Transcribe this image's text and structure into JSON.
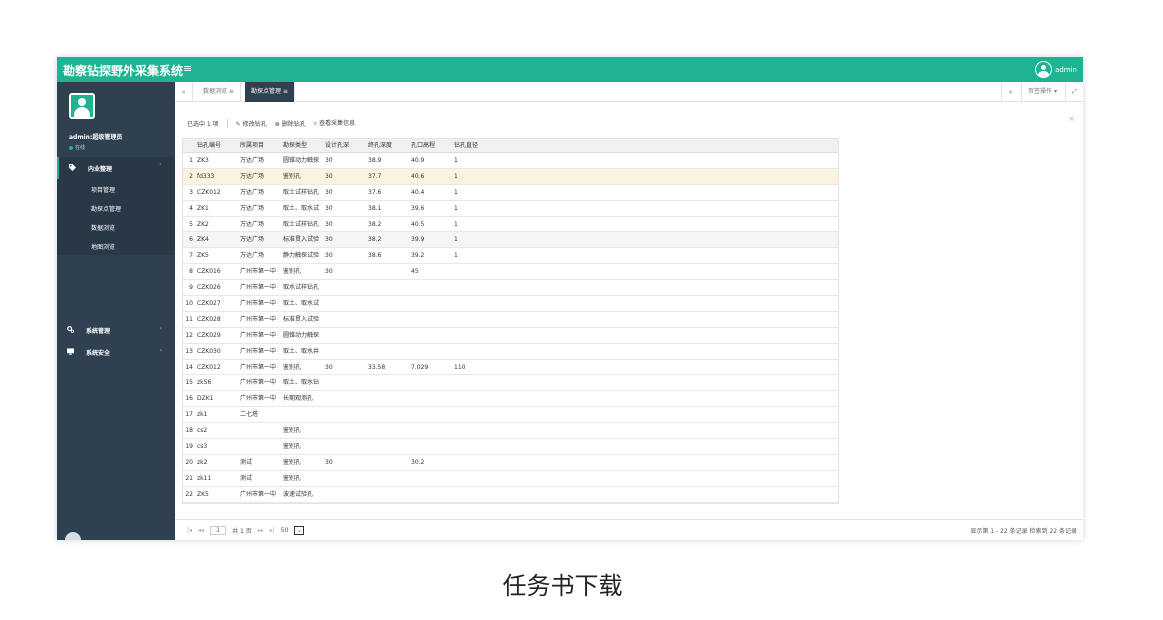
{
  "app": {
    "title": "勘察钻探野外采集系统",
    "menu_toggle": "≡",
    "user": "admin"
  },
  "sidebar": {
    "user_name": "admin:超级管理员",
    "status": "在线",
    "groups": [
      {
        "label": "内业整理",
        "icon": "tag-icon",
        "arrow": "˅",
        "items": [
          "项目管理",
          "勘探点管理",
          "数据浏览",
          "地图浏览"
        ]
      },
      {
        "label": "系统管理",
        "icon": "cogs-icon",
        "arrow": "‹"
      },
      {
        "label": "系统安全",
        "icon": "monitor-icon",
        "arrow": "‹"
      }
    ]
  },
  "tabs": {
    "back": "«",
    "forward": "»",
    "items": [
      {
        "label": "数据浏览 ≡"
      },
      {
        "label": "勘探点管理 ≡"
      }
    ],
    "page_ops": "页签操作 ▾",
    "fullscreen": "⤢"
  },
  "toolbar": {
    "selected": "已选中 1 项",
    "edit": "修改钻孔",
    "delete": "删除钻孔",
    "view": "查看采集信息",
    "close": "×"
  },
  "table": {
    "columns": [
      "",
      "钻孔编号",
      "所属项目",
      "勘探类型",
      "设计孔深",
      "终孔深度",
      "孔口高程",
      "钻孔直径"
    ],
    "rows": [
      [
        "1",
        "ZK3",
        "万达广场",
        "圆锥动力触探",
        "30",
        "38.9",
        "40.9",
        "1"
      ],
      [
        "2",
        "fd333",
        "万达广场",
        "鉴别孔",
        "30",
        "37.7",
        "40.6",
        "1"
      ],
      [
        "3",
        "CZK012",
        "万达广场",
        "取土试样钻孔",
        "30",
        "37.6",
        "40.4",
        "1"
      ],
      [
        "4",
        "ZK1",
        "万达广场",
        "取土、取水试",
        "30",
        "38.1",
        "39.6",
        "1"
      ],
      [
        "5",
        "ZK2",
        "万达广场",
        "取土试样钻孔",
        "30",
        "38.2",
        "40.5",
        "1"
      ],
      [
        "6",
        "ZK4",
        "万达广场",
        "标准贯入试验",
        "30",
        "38.2",
        "39.9",
        "1"
      ],
      [
        "7",
        "ZK5",
        "万达广场",
        "静力触探试验",
        "30",
        "38.6",
        "39.2",
        "1"
      ],
      [
        "8",
        "CZK016",
        "广州市第一中",
        "鉴别孔",
        "30",
        "",
        "45",
        ""
      ],
      [
        "9",
        "CZK026",
        "广州市第一中",
        "取水试样钻孔",
        "",
        "",
        "",
        ""
      ],
      [
        "10",
        "CZK027",
        "广州市第一中",
        "取土、取水试",
        "",
        "",
        "",
        ""
      ],
      [
        "11",
        "CZK028",
        "广州市第一中",
        "标准贯入试验",
        "",
        "",
        "",
        ""
      ],
      [
        "12",
        "CZK029",
        "广州市第一中",
        "圆锥动力触探",
        "",
        "",
        "",
        ""
      ],
      [
        "13",
        "CZK030",
        "广州市第一中",
        "取土、取水井",
        "",
        "",
        "",
        ""
      ],
      [
        "14",
        "CZK012",
        "广州市第一中",
        "鉴别孔",
        "30",
        "33.58",
        "7.029",
        "110"
      ],
      [
        "15",
        "zk56",
        "广州市第一中",
        "取土、取水钻",
        "",
        "",
        "",
        ""
      ],
      [
        "16",
        "DZK1",
        "广州市第一中",
        "长期观测孔",
        "",
        "",
        "",
        ""
      ],
      [
        "17",
        "zk1",
        "二七塔",
        "",
        "",
        "",
        "",
        ""
      ],
      [
        "18",
        "cs2",
        "",
        "鉴别孔",
        "",
        "",
        "",
        ""
      ],
      [
        "19",
        "cs3",
        "",
        "鉴别孔",
        "",
        "",
        "",
        ""
      ],
      [
        "20",
        "zk2",
        "测试",
        "鉴别孔",
        "30",
        "",
        "30.2",
        ""
      ],
      [
        "21",
        "zk11",
        "测试",
        "鉴别孔",
        "",
        "",
        "",
        ""
      ],
      [
        "22",
        "ZK5",
        "广州市第一中",
        "波速试验孔",
        "",
        "",
        "",
        ""
      ]
    ]
  },
  "pager": {
    "first": "|◂",
    "prev": "◂◂",
    "page": "1",
    "total": "共 1 页",
    "next": "▸▸",
    "last": "▸|",
    "page_size": "50",
    "info_display": "显示第 1 - 22 条记录",
    "info_total": "检索到 22 条记录"
  },
  "caption": "任务书下载",
  "colors": {
    "topbar": "#1fb392",
    "sidebar": "#2f4050",
    "highlight_row": "#fcf3dd"
  }
}
